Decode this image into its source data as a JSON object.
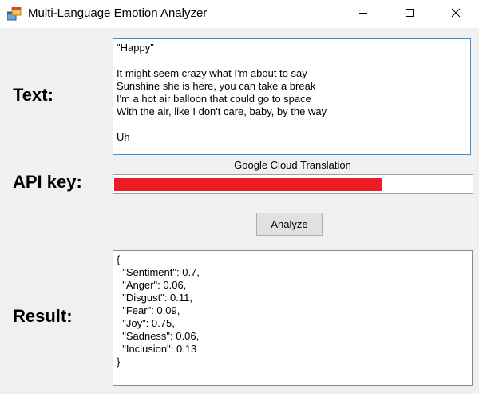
{
  "window": {
    "title": "Multi-Language Emotion Analyzer",
    "icon": "app-window-icon",
    "controls": [
      "minimize-icon",
      "maximize-icon",
      "close-icon"
    ]
  },
  "labels": {
    "text": "Text:",
    "api_key": "API key:",
    "result": "Result:"
  },
  "text_input": {
    "lines": [
      "\"Happy\"",
      "",
      "It might seem crazy what I'm about to say",
      "Sunshine she is here, you can take a break",
      "I'm a hot air balloon that could go to space",
      "With the air, like I don't care, baby, by the way",
      "",
      "Uh"
    ]
  },
  "api": {
    "caption": "Google Cloud Translation",
    "masked_fill_fraction": 0.75,
    "mask_color": "#ec1c24"
  },
  "analyze_button": {
    "label": "Analyze"
  },
  "result": {
    "lines": [
      "{",
      "  \"Sentiment\": 0.7,",
      "  \"Anger\": 0.06,",
      "  \"Disgust\": 0.11,",
      "  \"Fear\": 0.09,",
      "  \"Joy\": 0.75,",
      "  \"Sadness\": 0.06,",
      "  \"Inclusion\": 0.13",
      "}"
    ]
  },
  "colors": {
    "focus_border": "#3c8ed6",
    "window_bg": "#f0f0f0"
  }
}
